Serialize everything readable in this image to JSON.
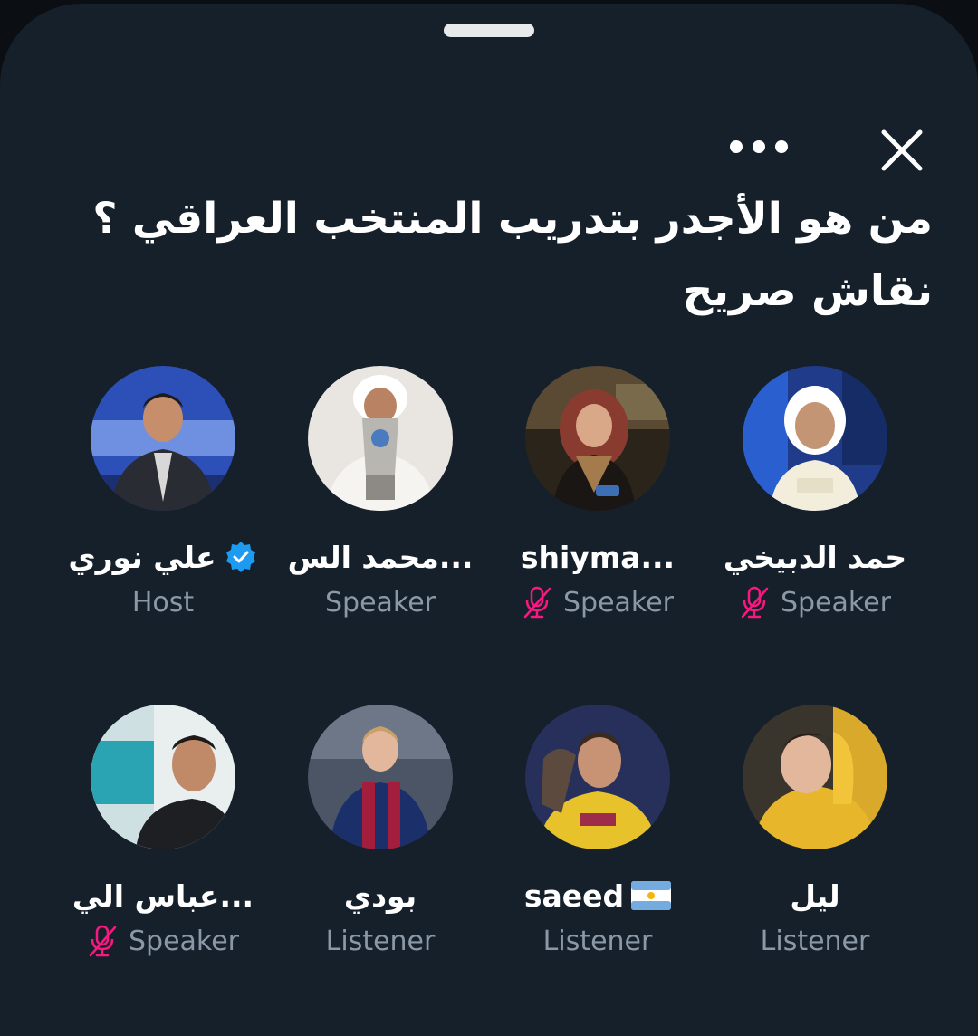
{
  "space": {
    "title": "من هو الأجدر بتدريب المنتخب العراقي ؟ نقاش صريح",
    "close_icon": "close-icon",
    "more_icon": "more-horizontal-icon"
  },
  "colors": {
    "sheet_bg": "#15202b",
    "text_primary": "#ffffff",
    "text_secondary": "#8b98a5",
    "verified": "#1d9bf0",
    "muted_mic": "#f91880"
  },
  "participants": [
    {
      "name": "حمد الدبيخي",
      "role": "Speaker",
      "muted": true
    },
    {
      "name": "shiyma...",
      "role": "Speaker",
      "muted": true
    },
    {
      "name": "محمد الس...",
      "role": "Speaker",
      "muted": false
    },
    {
      "name": "علي نوري",
      "role": "Host",
      "verified": true,
      "muted": false
    },
    {
      "name": "ليل",
      "role": "Listener"
    },
    {
      "name": "saeed",
      "role": "Listener",
      "flag": "argentina-flag-icon"
    },
    {
      "name": "بودي",
      "role": "Listener"
    },
    {
      "name": "عباس الي...",
      "role": "Speaker",
      "muted": true
    }
  ]
}
